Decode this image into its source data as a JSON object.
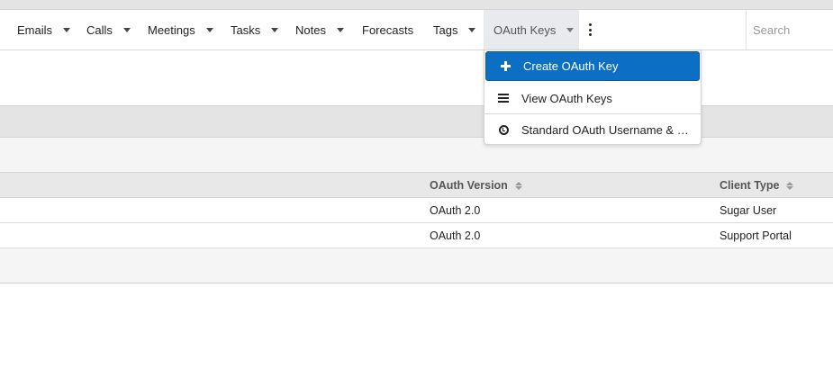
{
  "nav": {
    "items": [
      {
        "label": "Emails"
      },
      {
        "label": "Calls"
      },
      {
        "label": "Meetings"
      },
      {
        "label": "Tasks"
      },
      {
        "label": "Notes"
      },
      {
        "label": "Forecasts"
      },
      {
        "label": "Tags"
      },
      {
        "label": "OAuth Keys"
      }
    ],
    "search_placeholder": "Search"
  },
  "dropdown": {
    "items": [
      {
        "label": "Create OAuth Key",
        "icon": "plus-icon"
      },
      {
        "label": "View OAuth Keys",
        "icon": "list-icon"
      },
      {
        "label": "Standard OAuth Username & P...",
        "icon": "clock-icon"
      }
    ]
  },
  "table": {
    "columns": [
      "OAuth Version",
      "Client Type"
    ],
    "rows": [
      [
        "OAuth 2.0",
        "Sugar User"
      ],
      [
        "OAuth 2.0",
        "Support Portal"
      ]
    ]
  },
  "colors": {
    "accent": "#0d6fc4",
    "active_tab_bg": "#e8eaed"
  }
}
